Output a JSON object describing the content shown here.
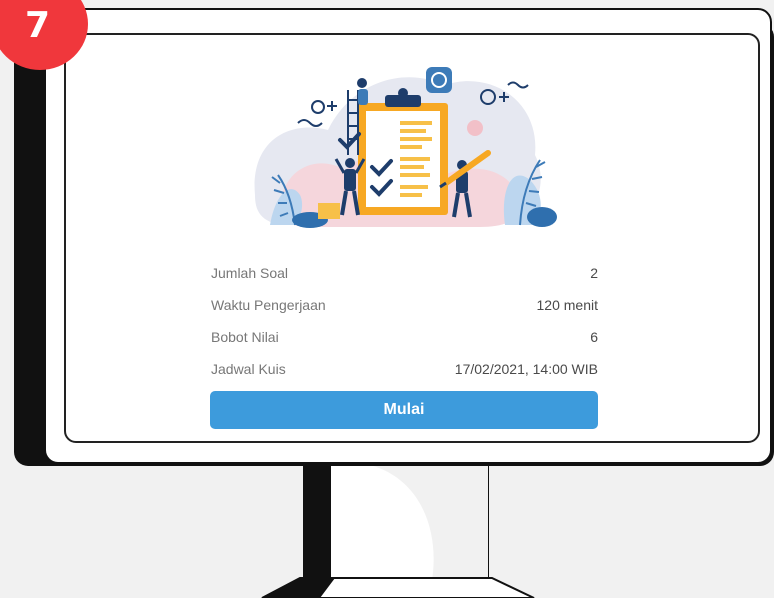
{
  "step": {
    "number": "7",
    "color": "#f0373c"
  },
  "quiz": {
    "rows": [
      {
        "label": "Jumlah Soal",
        "value": "2"
      },
      {
        "label": "Waktu Pengerjaan",
        "value": "120 menit"
      },
      {
        "label": "Bobot Nilai",
        "value": "6"
      },
      {
        "label": "Jadwal Kuis",
        "value": "17/02/2021, 14:00 WIB"
      }
    ],
    "start_label": "Mulai"
  },
  "colors": {
    "accent": "#3d9bdc",
    "clipboard": "#f7a823",
    "figure": "#1e3d6b"
  },
  "icons": [
    "clipboard-checklist-illustration",
    "check-icon",
    "pencil-icon"
  ]
}
